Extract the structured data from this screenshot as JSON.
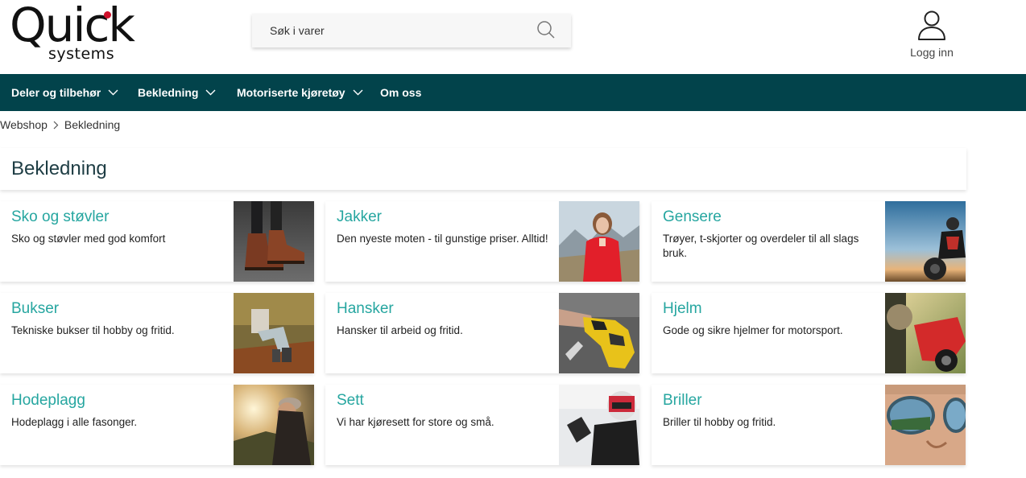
{
  "logo": {
    "word1": "Quick",
    "word2": "systems"
  },
  "search": {
    "placeholder": "Søk i varer"
  },
  "login": {
    "label": "Logg inn"
  },
  "nav": {
    "items": [
      {
        "label": "Deler og tilbehør"
      },
      {
        "label": "Bekledning"
      },
      {
        "label": "Motoriserte kjøretøy"
      },
      {
        "label": "Om oss"
      }
    ]
  },
  "breadcrumb": {
    "home": "Webshop",
    "current": "Bekledning"
  },
  "page": {
    "title": "Bekledning"
  },
  "categories": [
    {
      "title": "Sko og støvler",
      "description": "Sko og støvler med god komfort"
    },
    {
      "title": "Jakker",
      "description": "Den nyeste moten - til gunstige priser. Alltid!"
    },
    {
      "title": "Gensere",
      "description": "Trøyer, t-skjorter og overdeler til all slags bruk."
    },
    {
      "title": "Bukser",
      "description": "Tekniske bukser til hobby og fritid."
    },
    {
      "title": "Hansker",
      "description": "Hansker til arbeid og fritid."
    },
    {
      "title": "Hjelm",
      "description": "Gode og sikre hjelmer for motorsport."
    },
    {
      "title": "Hodeplagg",
      "description": "Hodeplagg i alle fasonger."
    },
    {
      "title": "Sett",
      "description": "Vi har kjøresett for store og små."
    },
    {
      "title": "Briller",
      "description": "Briller til hobby og fritid."
    }
  ],
  "colors": {
    "nav_bg": "#02434b",
    "accent": "#26a6a0",
    "logo_dot": "#d0112b"
  }
}
